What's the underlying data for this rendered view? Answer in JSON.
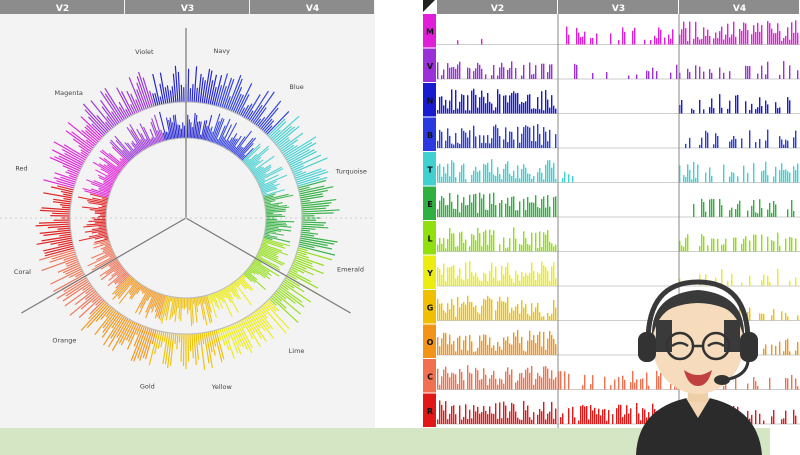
{
  "colors": {
    "header_bg": "#8c8c8c",
    "header_text": "#ffffff",
    "circle_bg": "#f3f3f3",
    "band": "#d4e6c4"
  },
  "left_panel": {
    "headers": [
      "V2",
      "V3",
      "V4"
    ],
    "sector_labels": [
      {
        "text": "Navy",
        "angle": 78
      },
      {
        "text": "Blue",
        "angle": 50
      },
      {
        "text": "Turquoise",
        "angle": 16
      },
      {
        "text": "Emerald",
        "angle": -17
      },
      {
        "text": "Lime",
        "angle": -50
      },
      {
        "text": "Yellow",
        "angle": -78
      },
      {
        "text": "Gold",
        "angle": -103
      },
      {
        "text": "Orange",
        "angle": -135
      },
      {
        "text": "Coral",
        "angle": -162
      },
      {
        "text": "Red",
        "angle": 163
      },
      {
        "text": "Magenta",
        "angle": 133
      },
      {
        "text": "Violet",
        "angle": 104
      }
    ]
  },
  "right_panel": {
    "headers": [
      "V2",
      "V3",
      "V4"
    ],
    "rows": [
      {
        "label": "M",
        "color": "#e020d8",
        "activity": [
          0.05,
          0.45,
          0.9
        ]
      },
      {
        "label": "V",
        "color": "#9a30d8",
        "activity": [
          0.5,
          0.25,
          0.45
        ]
      },
      {
        "label": "N",
        "color": "#1a1ad0",
        "activity": [
          0.95,
          0.0,
          0.55
        ]
      },
      {
        "label": "B",
        "color": "#2a3ae0",
        "activity": [
          0.9,
          0.0,
          0.5
        ]
      },
      {
        "label": "T",
        "color": "#40d0d0",
        "activity": [
          0.85,
          0.05,
          0.65
        ]
      },
      {
        "label": "E",
        "color": "#30b040",
        "activity": [
          0.95,
          0.0,
          0.6
        ]
      },
      {
        "label": "L",
        "color": "#90e010",
        "activity": [
          0.9,
          0.0,
          0.55
        ]
      },
      {
        "label": "Y",
        "color": "#ecec10",
        "activity": [
          0.95,
          0.0,
          0.4
        ]
      },
      {
        "label": "G",
        "color": "#f0c000",
        "activity": [
          0.95,
          0.0,
          0.4
        ]
      },
      {
        "label": "O",
        "color": "#f29418",
        "activity": [
          0.95,
          0.0,
          0.4
        ]
      },
      {
        "label": "C",
        "color": "#f07050",
        "activity": [
          0.95,
          0.5,
          0.35
        ]
      },
      {
        "label": "R",
        "color": "#e01818",
        "activity": [
          0.95,
          0.7,
          0.5
        ]
      }
    ]
  }
}
